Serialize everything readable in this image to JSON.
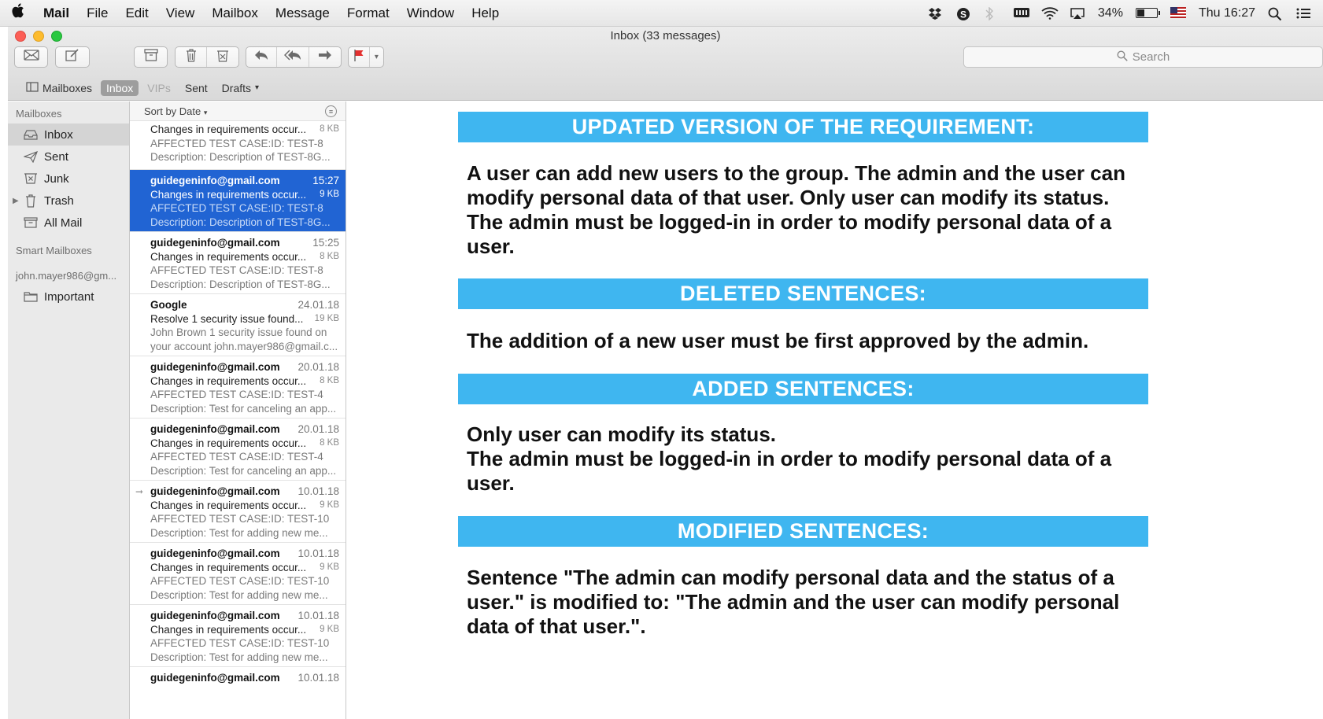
{
  "menubar": {
    "apple": "",
    "items": [
      "Mail",
      "File",
      "Edit",
      "View",
      "Mailbox",
      "Message",
      "Format",
      "Window",
      "Help"
    ],
    "battery_pct": "34%",
    "battery_level": 0.34,
    "clock": "Thu 16:27"
  },
  "window": {
    "title": "Inbox (33 messages)"
  },
  "toolbar": {
    "search_placeholder": "Search"
  },
  "favorites": {
    "mailboxes": "Mailboxes",
    "inbox": "Inbox",
    "vips": "VIPs",
    "sent": "Sent",
    "drafts": "Drafts"
  },
  "sidebar": {
    "heading": "Mailboxes",
    "items": [
      {
        "label": "Inbox",
        "icon": "inbox-icon"
      },
      {
        "label": "Sent",
        "icon": "sent-icon"
      },
      {
        "label": "Junk",
        "icon": "junk-icon"
      },
      {
        "label": "Trash",
        "icon": "trash-icon"
      },
      {
        "label": "All Mail",
        "icon": "archive-icon"
      }
    ],
    "smart_heading": "Smart Mailboxes",
    "account_heading": "john.mayer986@gm...",
    "account_items": [
      {
        "label": "Important",
        "icon": "folder-icon"
      }
    ]
  },
  "list": {
    "sort_label": "Sort by Date",
    "messages": [
      {
        "from": "",
        "date": "",
        "subject": "Changes in requirements occur...",
        "size": "8 KB",
        "line1": "AFFECTED TEST CASE:ID: TEST-8",
        "line2": "Description: Description of TEST-8G..."
      },
      {
        "from": "guidegeninfo@gmail.com",
        "date": "15:27",
        "subject": "Changes in requirements occur...",
        "size": "9 KB",
        "line1": "AFFECTED TEST CASE:ID: TEST-8",
        "line2": "Description: Description of TEST-8G..."
      },
      {
        "from": "guidegeninfo@gmail.com",
        "date": "15:25",
        "subject": "Changes in requirements occur...",
        "size": "8 KB",
        "line1": "AFFECTED TEST CASE:ID: TEST-8",
        "line2": "Description: Description of TEST-8G..."
      },
      {
        "from": "Google",
        "date": "24.01.18",
        "subject": "Resolve 1 security issue found...",
        "size": "19 KB",
        "line1": "John Brown 1 security issue found on",
        "line2": "your account john.mayer986@gmail.c..."
      },
      {
        "from": "guidegeninfo@gmail.com",
        "date": "20.01.18",
        "subject": "Changes in requirements occur...",
        "size": "8 KB",
        "line1": "AFFECTED TEST CASE:ID: TEST-4",
        "line2": "Description: Test for canceling an app..."
      },
      {
        "from": "guidegeninfo@gmail.com",
        "date": "20.01.18",
        "subject": "Changes in requirements occur...",
        "size": "8 KB",
        "line1": "AFFECTED TEST CASE:ID: TEST-4",
        "line2": "Description: Test for canceling an app..."
      },
      {
        "from": "guidegeninfo@gmail.com",
        "date": "10.01.18",
        "subject": "Changes in requirements occur...",
        "size": "9 KB",
        "line1": "AFFECTED TEST CASE:ID: TEST-10",
        "line2": "Description: Test for adding new me..."
      },
      {
        "from": "guidegeninfo@gmail.com",
        "date": "10.01.18",
        "subject": "Changes in requirements occur...",
        "size": "9 KB",
        "line1": "AFFECTED TEST CASE:ID: TEST-10",
        "line2": "Description: Test for adding new me..."
      },
      {
        "from": "guidegeninfo@gmail.com",
        "date": "10.01.18",
        "subject": "Changes in requirements occur...",
        "size": "9 KB",
        "line1": "AFFECTED TEST CASE:ID: TEST-10",
        "line2": "Description: Test for adding new me..."
      },
      {
        "from": "guidegeninfo@gmail.com",
        "date": "10.01.18",
        "subject": "",
        "size": "",
        "line1": "",
        "line2": ""
      }
    ]
  },
  "message": {
    "sections": [
      {
        "heading": "UPDATED VERSION OF THE REQUIREMENT:",
        "body": "A user can add new users to the group. The admin and the user can modify personal data of that user. Only user can modify its status. The admin must be logged-in in order to modify personal data of a user."
      },
      {
        "heading": "DELETED SENTENCES:",
        "body": "The addition of a new user must be first approved by the admin."
      },
      {
        "heading": "ADDED SENTENCES:",
        "body": "Only user can modify its status.\nThe admin must be logged-in in order to modify personal data of a user."
      },
      {
        "heading": "MODIFIED SENTENCES:",
        "body": "Sentence \"The admin can modify personal data and the status of a user.\" is modified to: \"The admin and the user can modify personal data of that user.\"."
      }
    ]
  },
  "colors": {
    "banner": "#3fb6f0",
    "selection": "#2164d3"
  }
}
